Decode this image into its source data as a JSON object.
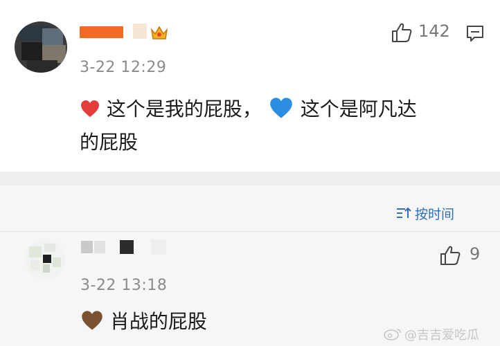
{
  "comments": [
    {
      "time": "3-22 12:29",
      "likes": "142",
      "line1_a": "这个是我的屁股，",
      "line1_b": "这个是阿凡达",
      "line2": "的屁股",
      "emoji1": "❤️",
      "emoji2": "💙"
    }
  ],
  "sort": {
    "label": "按时间"
  },
  "replies": [
    {
      "time": "3-22 13:18",
      "likes": "9",
      "emoji": "🤎",
      "text": "肖战的屁股"
    }
  ],
  "icons": {
    "like": "thumbs-up-icon",
    "comment": "comment-icon",
    "sort": "sort-icon",
    "crown": "crown-badge-icon"
  },
  "colors": {
    "heart_red": "#e43b3b",
    "heart_blue": "#2b8de0",
    "heart_brown": "#7a5232",
    "link_blue": "#2f6fb8",
    "name_orange": "#f26a21"
  },
  "watermark": "@吉吉爱吃瓜"
}
